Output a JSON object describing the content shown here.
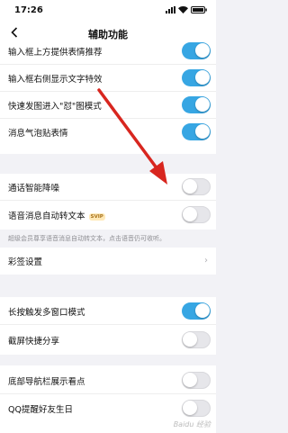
{
  "status_bar": {
    "time": "17:26"
  },
  "nav": {
    "title": "辅助功能"
  },
  "group1": [
    {
      "label": "输入框上方提供表情推荐",
      "on": true
    },
    {
      "label": "输入框右侧显示文字特效",
      "on": true
    },
    {
      "label": "快速发图进入\"怼\"图模式",
      "on": true
    },
    {
      "label": "消息气泡贴表情",
      "on": true
    }
  ],
  "group2": [
    {
      "label": "通话智能降噪",
      "on": false
    },
    {
      "label": "语音消息自动转文本",
      "badge": "SVIP",
      "on": false
    }
  ],
  "hint": "超级会员尊享语音消息自动转文本，点击语音仍可收听。",
  "group3": {
    "label": "彩签设置"
  },
  "group4": [
    {
      "label": "长按触发多窗口模式",
      "on": true
    },
    {
      "label": "截屏快捷分享",
      "on": false
    }
  ],
  "group5": [
    {
      "label": "底部导航栏展示看点",
      "on": false
    },
    {
      "label": "QQ提醒好友生日",
      "on": false
    }
  ],
  "colors": {
    "toggle_on": "#37a6e3",
    "arrow": "#d8261f"
  },
  "watermark": "Baidu 经验"
}
